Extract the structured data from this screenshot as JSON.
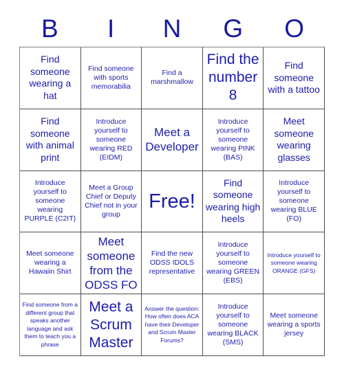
{
  "card": {
    "title": "BINGO",
    "header_letters": [
      "B",
      "I",
      "N",
      "G",
      "O"
    ],
    "accent_color": "#19199e",
    "text_color": "#1c1cab",
    "grid_line_color": "#4d4d4d",
    "background_color": "#ffffff",
    "rows": 5,
    "columns": 5,
    "cells": [
      {
        "text": "Find someone wearing a hat",
        "size": "medium",
        "free": false
      },
      {
        "text": "Find someone with sports memorabilia",
        "size": "small",
        "free": false
      },
      {
        "text": "Find a marshmallow",
        "size": "small",
        "free": false
      },
      {
        "text": "Find the number 8",
        "size": "xlarge",
        "free": false
      },
      {
        "text": "Find someone with a tattoo",
        "size": "medium",
        "free": false
      },
      {
        "text": "Find someone with animal print",
        "size": "medium",
        "free": false
      },
      {
        "text": "Introduce yourself to someone wearing RED (EIDM)",
        "size": "small",
        "free": false
      },
      {
        "text": "Meet a Developer",
        "size": "large",
        "free": false
      },
      {
        "text": "Introduce yourself to someone wearing PINK (BAS)",
        "size": "small",
        "free": false
      },
      {
        "text": "Meet someone wearing glasses",
        "size": "medium",
        "free": false
      },
      {
        "text": "Introduce yourself to someone wearing PURPLE (C2IT)",
        "size": "small",
        "free": false
      },
      {
        "text": "Meet a Group Chief or Deputy Chief not in your group",
        "size": "small",
        "free": false
      },
      {
        "text": "Free!",
        "size": "free",
        "free": true
      },
      {
        "text": "Find someone wearing high heels",
        "size": "medium",
        "free": false
      },
      {
        "text": "Introduce yourself to someone wearing BLUE (FO)",
        "size": "small",
        "free": false
      },
      {
        "text": "Meet someone wearing a Hawaiin Shirt",
        "size": "small",
        "free": false
      },
      {
        "text": "Meet someone from the ODSS FO",
        "size": "large",
        "free": false
      },
      {
        "text": "Find the new ODSS IDOLS representative",
        "size": "small",
        "free": false
      },
      {
        "text": "Introduce yourself to someone wearing GREEN (EBS)",
        "size": "small",
        "free": false
      },
      {
        "text": "Introduce yourself to someone wearing ORANGE (GFS)",
        "size": "xsmall",
        "free": false
      },
      {
        "text": "Find someone from a different group that speaks another language and ask them to teach you a phrase",
        "size": "xsmall",
        "free": false
      },
      {
        "text": "Meet a Scrum Master",
        "size": "xlarge",
        "free": false
      },
      {
        "text": "Answer the question: How often does ACA have their Developer and Scrum Master Forums?",
        "size": "xsmall",
        "free": false
      },
      {
        "text": "Introduce yourself to someone wearing BLACK (SMS)",
        "size": "small",
        "free": false
      },
      {
        "text": "Meet someone wearing a sports jersey",
        "size": "small",
        "free": false
      }
    ]
  }
}
